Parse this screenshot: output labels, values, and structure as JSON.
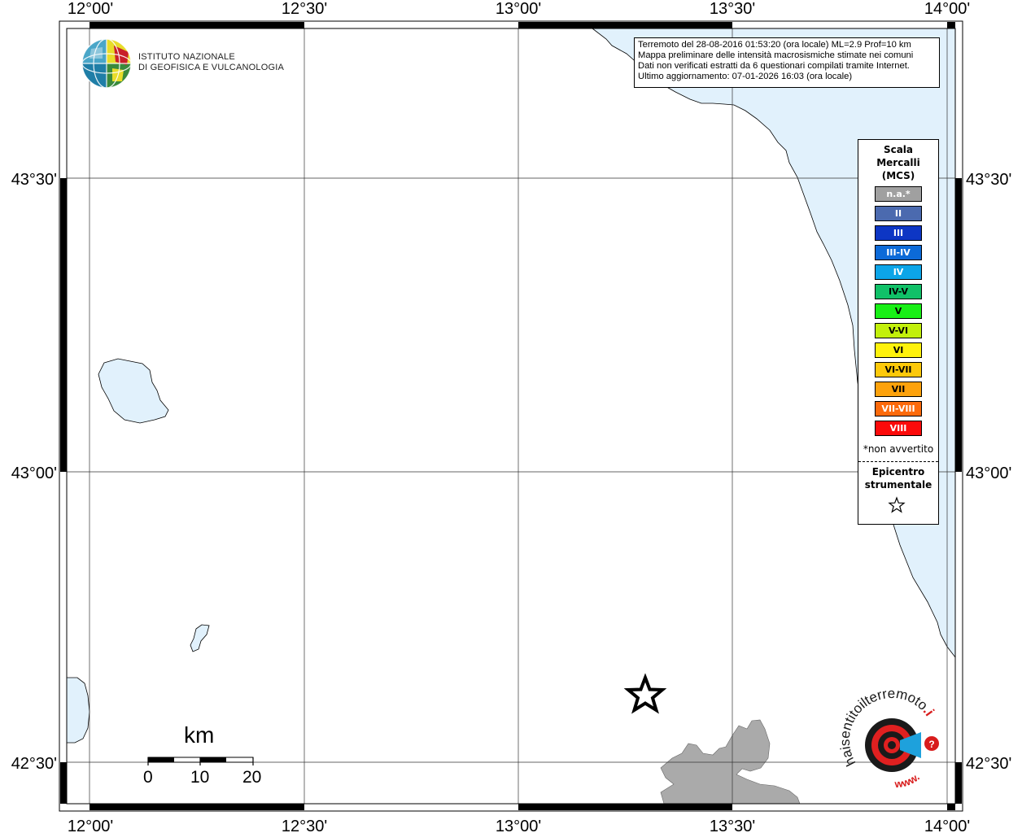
{
  "map": {
    "top_lon_labels": [
      "12°00'",
      "12°30'",
      "13°00'",
      "13°30'",
      "14°00'"
    ],
    "bottom_lon_labels": [
      "12°00'",
      "12°30'",
      "13°00'",
      "13°30'",
      "14°00'"
    ],
    "left_lat_labels": [
      "43°30'",
      "43°00'",
      "42°30'"
    ],
    "right_lat_labels": [
      "43°30'",
      "43°00'",
      "42°30'"
    ],
    "sea_color": "#e1f1fc",
    "land_color": "#ffffff",
    "shaded_region_color": "#aaaaaa"
  },
  "logo": {
    "line1": "ISTITUTO NAZIONALE",
    "line2": "DI GEOFISICA E VULCANOLOGIA"
  },
  "info": {
    "line1": "Terremoto del 28-08-2016 01:53:20 (ora locale) ML=2.9 Prof=10 km",
    "line2": "Mappa preliminare delle intensità macrosismiche stimate nei comuni",
    "line3": "Dati non verificati estratti da 6 questionari compilati tramite Internet.",
    "line4": "Ultimo aggiornamento: 07-01-2026 16:03 (ora locale)"
  },
  "legend": {
    "title_lines": [
      "Scala",
      "Mercalli",
      "(MCS)"
    ],
    "items": [
      {
        "label": "n.a.*",
        "color": "#a0a0a0"
      },
      {
        "label": "II",
        "color": "#4b6aaf"
      },
      {
        "label": "III",
        "color": "#0d36c4"
      },
      {
        "label": "III-IV",
        "color": "#0c6ad8"
      },
      {
        "label": "IV",
        "color": "#0ca5e8"
      },
      {
        "label": "IV-V",
        "color": "#10c168"
      },
      {
        "label": "V",
        "color": "#18f016"
      },
      {
        "label": "V-VI",
        "color": "#c2f00b"
      },
      {
        "label": "VI",
        "color": "#fff20c"
      },
      {
        "label": "VI-VII",
        "color": "#fdc90a"
      },
      {
        "label": "VII",
        "color": "#fda20c"
      },
      {
        "label": "VII-VIII",
        "color": "#fc6a0b"
      },
      {
        "label": "VIII",
        "color": "#fc0a0a"
      }
    ],
    "na_note": "*non avvertito",
    "epicenter_lines": [
      "Epicentro",
      "strumentale"
    ]
  },
  "scale": {
    "title": "km",
    "ticks": [
      "0",
      "10",
      "20"
    ]
  },
  "brand": {
    "text_black": "haisentitoilterremoto",
    "text_red": ".it",
    "text_www": "www."
  }
}
